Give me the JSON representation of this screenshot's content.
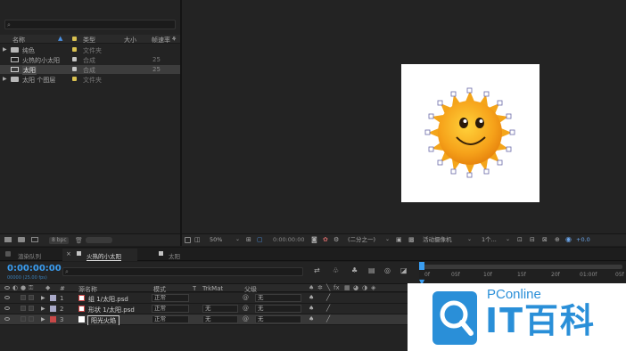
{
  "project": {
    "columns": {
      "name": "名称",
      "type": "类型",
      "size": "大小",
      "fps": "帧速率"
    },
    "items": [
      {
        "name": "纯色",
        "type": "文件夹",
        "fps": "",
        "color": "#d8c050",
        "kind": "folder"
      },
      {
        "name": "火热的小太阳",
        "type": "合成",
        "fps": "25",
        "color": "#c4c4c4",
        "kind": "comp"
      },
      {
        "name": "太阳",
        "type": "合成",
        "fps": "25",
        "color": "#c4c4c4",
        "kind": "comp"
      },
      {
        "name": "太阳 个图层",
        "type": "文件夹",
        "fps": "",
        "color": "#d8c050",
        "kind": "folder"
      }
    ],
    "bpc": "8 bpc"
  },
  "viewer": {
    "zoom": "50%",
    "timecode": "0:00:00:00",
    "resolution": "(二分之一)",
    "camera": "活动摄像机",
    "views": "1个...",
    "exposure": "+0.0"
  },
  "timeline": {
    "tabs": [
      {
        "label": "渲染队列"
      },
      {
        "label": "火热的小太阳"
      },
      {
        "label": "太阳"
      }
    ],
    "current_time": "0:00:00:00",
    "frames": "00000 (25.00 fps)",
    "columns": {
      "num": "#",
      "source": "源名称",
      "mode": "模式",
      "t": "T",
      "trkmat": "TrkMat",
      "parent": "父级"
    },
    "layers": [
      {
        "num": "1",
        "name": "组 1/太阳.psd",
        "mode": "正常",
        "trkmat": "",
        "parent": "无",
        "label_color": "#a9a9c8"
      },
      {
        "num": "2",
        "name": "形状 1/太阳.psd",
        "mode": "正常",
        "trkmat": "无",
        "parent": "无",
        "label_color": "#a9a9c8"
      },
      {
        "num": "3",
        "name": "阳光火焰",
        "mode": "正常",
        "trkmat": "无",
        "parent": "无",
        "label_color": "#c84848"
      }
    ],
    "ruler": [
      "0f",
      "05f",
      "10f",
      "15f",
      "20f",
      "01:00f",
      "05f"
    ]
  },
  "watermark": {
    "sub": "PConline",
    "main": "IT百科",
    "color": "#2a8fd8"
  }
}
